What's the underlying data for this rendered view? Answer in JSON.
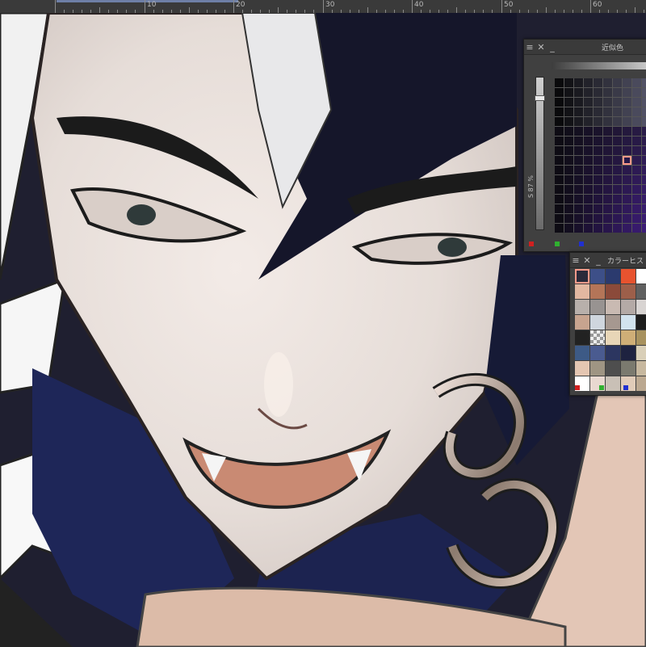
{
  "ruler": {
    "labels": [
      "10",
      "20",
      "30",
      "40",
      "50",
      "60"
    ]
  },
  "artwork": {
    "subject": "digital painting canvas"
  },
  "similar_panel": {
    "title": "近似色",
    "slider_label": "S 87 %",
    "slider_value": 0.87,
    "menu_icon": "menu-icon",
    "close_icon": "close-icon",
    "minimize_icon": "minimize-icon",
    "chips": [
      "#d02020",
      "#30b030",
      "#2030d0"
    ]
  },
  "history_panel": {
    "title": "カラーヒスト",
    "menu_icon": "menu-icon",
    "close_icon": "close-icon",
    "minimize_icon": "minimize-icon",
    "swatches": [
      "#2a2a3a",
      "#3d4f88",
      "#2b3a6e",
      "#e7532f",
      "#ffffff",
      "#e2b8a1",
      "#b47558",
      "#8b4a3a",
      "#9d5f4a",
      "#606060",
      "#b8b0ab",
      "#989391",
      "#c9bab2",
      "#b4aaa6",
      "#d8d4d2",
      "#c7a48f",
      "#cfd6de",
      "#a69890",
      "#d2e3ee",
      "#1d1d1d",
      "#222222",
      "checker",
      "#e8d6b7",
      "#cfae77",
      "#a8925f",
      "#3d5a86",
      "#4a5b90",
      "#2c3660",
      "#1e2240",
      "#d9cfb8",
      "#e4c6b2",
      "#9f9583",
      "#4e4e4e",
      "#7b7a6f",
      "#c7b89f",
      "#ffffff",
      "#e8d8d0",
      "#c9c0b6",
      "#e0cbb8",
      "#bba890"
    ],
    "chips": [
      "#d02020",
      "#30b030",
      "#2030d0"
    ]
  }
}
